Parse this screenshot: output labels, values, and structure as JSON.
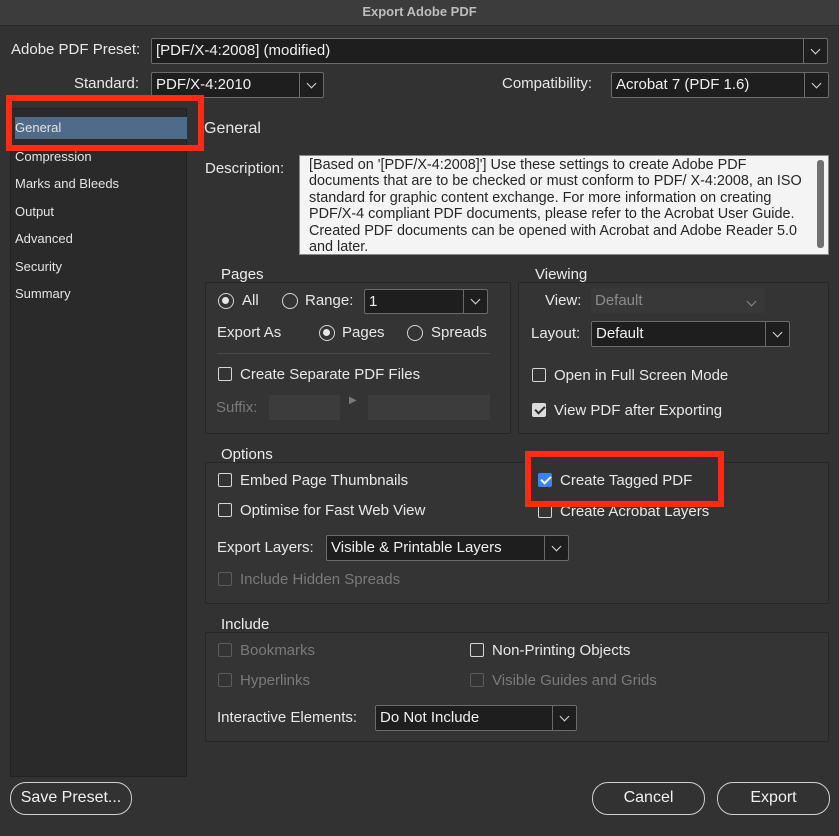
{
  "window": {
    "title": "Export Adobe PDF"
  },
  "preset": {
    "label": "Adobe PDF Preset:",
    "value": "[PDF/X-4:2008] (modified)"
  },
  "standard": {
    "label": "Standard:",
    "value": "PDF/X-4:2010"
  },
  "compatibility": {
    "label": "Compatibility:",
    "value": "Acrobat 7 (PDF 1.6)"
  },
  "sidebar": {
    "items": [
      {
        "label": "General",
        "selected": true
      },
      {
        "label": "Compression"
      },
      {
        "label": "Marks and Bleeds"
      },
      {
        "label": "Output"
      },
      {
        "label": "Advanced"
      },
      {
        "label": "Security"
      },
      {
        "label": "Summary"
      }
    ]
  },
  "panel": {
    "title": "General",
    "description_label": "Description:",
    "description_text": "[Based on '[PDF/X-4:2008]'] Use these settings to create Adobe PDF documents that are to be checked or must conform to PDF/ X-4:2008, an ISO standard for graphic content exchange.  For more information on creating PDF/X-4 compliant PDF documents, please refer to the Acrobat User Guide.  Created PDF documents can be opened with Acrobat and Adobe Reader 5.0 and later."
  },
  "pages": {
    "title": "Pages",
    "all_label": "All",
    "range_label": "Range:",
    "range_value": "1",
    "export_as_label": "Export As",
    "pages_label": "Pages",
    "spreads_label": "Spreads",
    "separate_files_label": "Create Separate PDF Files",
    "suffix_label": "Suffix:"
  },
  "viewing": {
    "title": "Viewing",
    "view_label": "View:",
    "view_value": "Default",
    "layout_label": "Layout:",
    "layout_value": "Default",
    "full_screen_label": "Open in Full Screen Mode",
    "view_after_label": "View PDF after Exporting"
  },
  "options": {
    "title": "Options",
    "thumbnails_label": "Embed Page Thumbnails",
    "fast_web_label": "Optimise for Fast Web View",
    "tagged_pdf_label": "Create Tagged PDF",
    "acrobat_layers_label": "Create Acrobat Layers",
    "export_layers_label": "Export Layers:",
    "export_layers_value": "Visible & Printable Layers",
    "hidden_spreads_label": "Include Hidden Spreads"
  },
  "include": {
    "title": "Include",
    "bookmarks_label": "Bookmarks",
    "hyperlinks_label": "Hyperlinks",
    "non_printing_label": "Non-Printing Objects",
    "guides_label": "Visible Guides and Grids",
    "interactive_label": "Interactive Elements:",
    "interactive_value": "Do Not Include"
  },
  "footer": {
    "save_preset": "Save Preset...",
    "cancel": "Cancel",
    "export": "Export"
  },
  "colors": {
    "background": "#323232",
    "selection": "#4e6b8a",
    "highlight": "#ff2a12",
    "checkbox_accent": "#3b82f6"
  }
}
